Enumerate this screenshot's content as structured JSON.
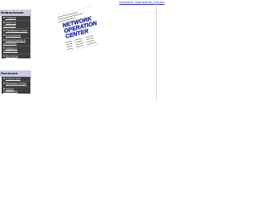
{
  "top_link": "Network Operations Center",
  "sections": [
    {
      "title": "Информация",
      "items": [
        {
          "label": "Главная"
        },
        {
          "label": "Новости компании"
        },
        {
          "label": "Тарифные планы"
        },
        {
          "label": "О компании"
        },
        {
          "label": "Подключение и настройка"
        },
        {
          "label": "Сервис и поддержка"
        },
        {
          "label": "Контакты"
        }
      ]
    },
    {
      "title": "Полезное",
      "items": [
        {
          "label": "Статистика"
        },
        {
          "label": "Проверка почты"
        },
        {
          "label": "Форум поддержки"
        }
      ]
    }
  ],
  "logo": {
    "line1": "NETWORK",
    "line2": "OPERATION",
    "line3": "CENTER"
  },
  "colors": {
    "menu_bg": "#3d3d3d",
    "section_header_bg": "#c9cbe0",
    "link": "#2030c0",
    "logo_text": "#1a2ad0"
  }
}
